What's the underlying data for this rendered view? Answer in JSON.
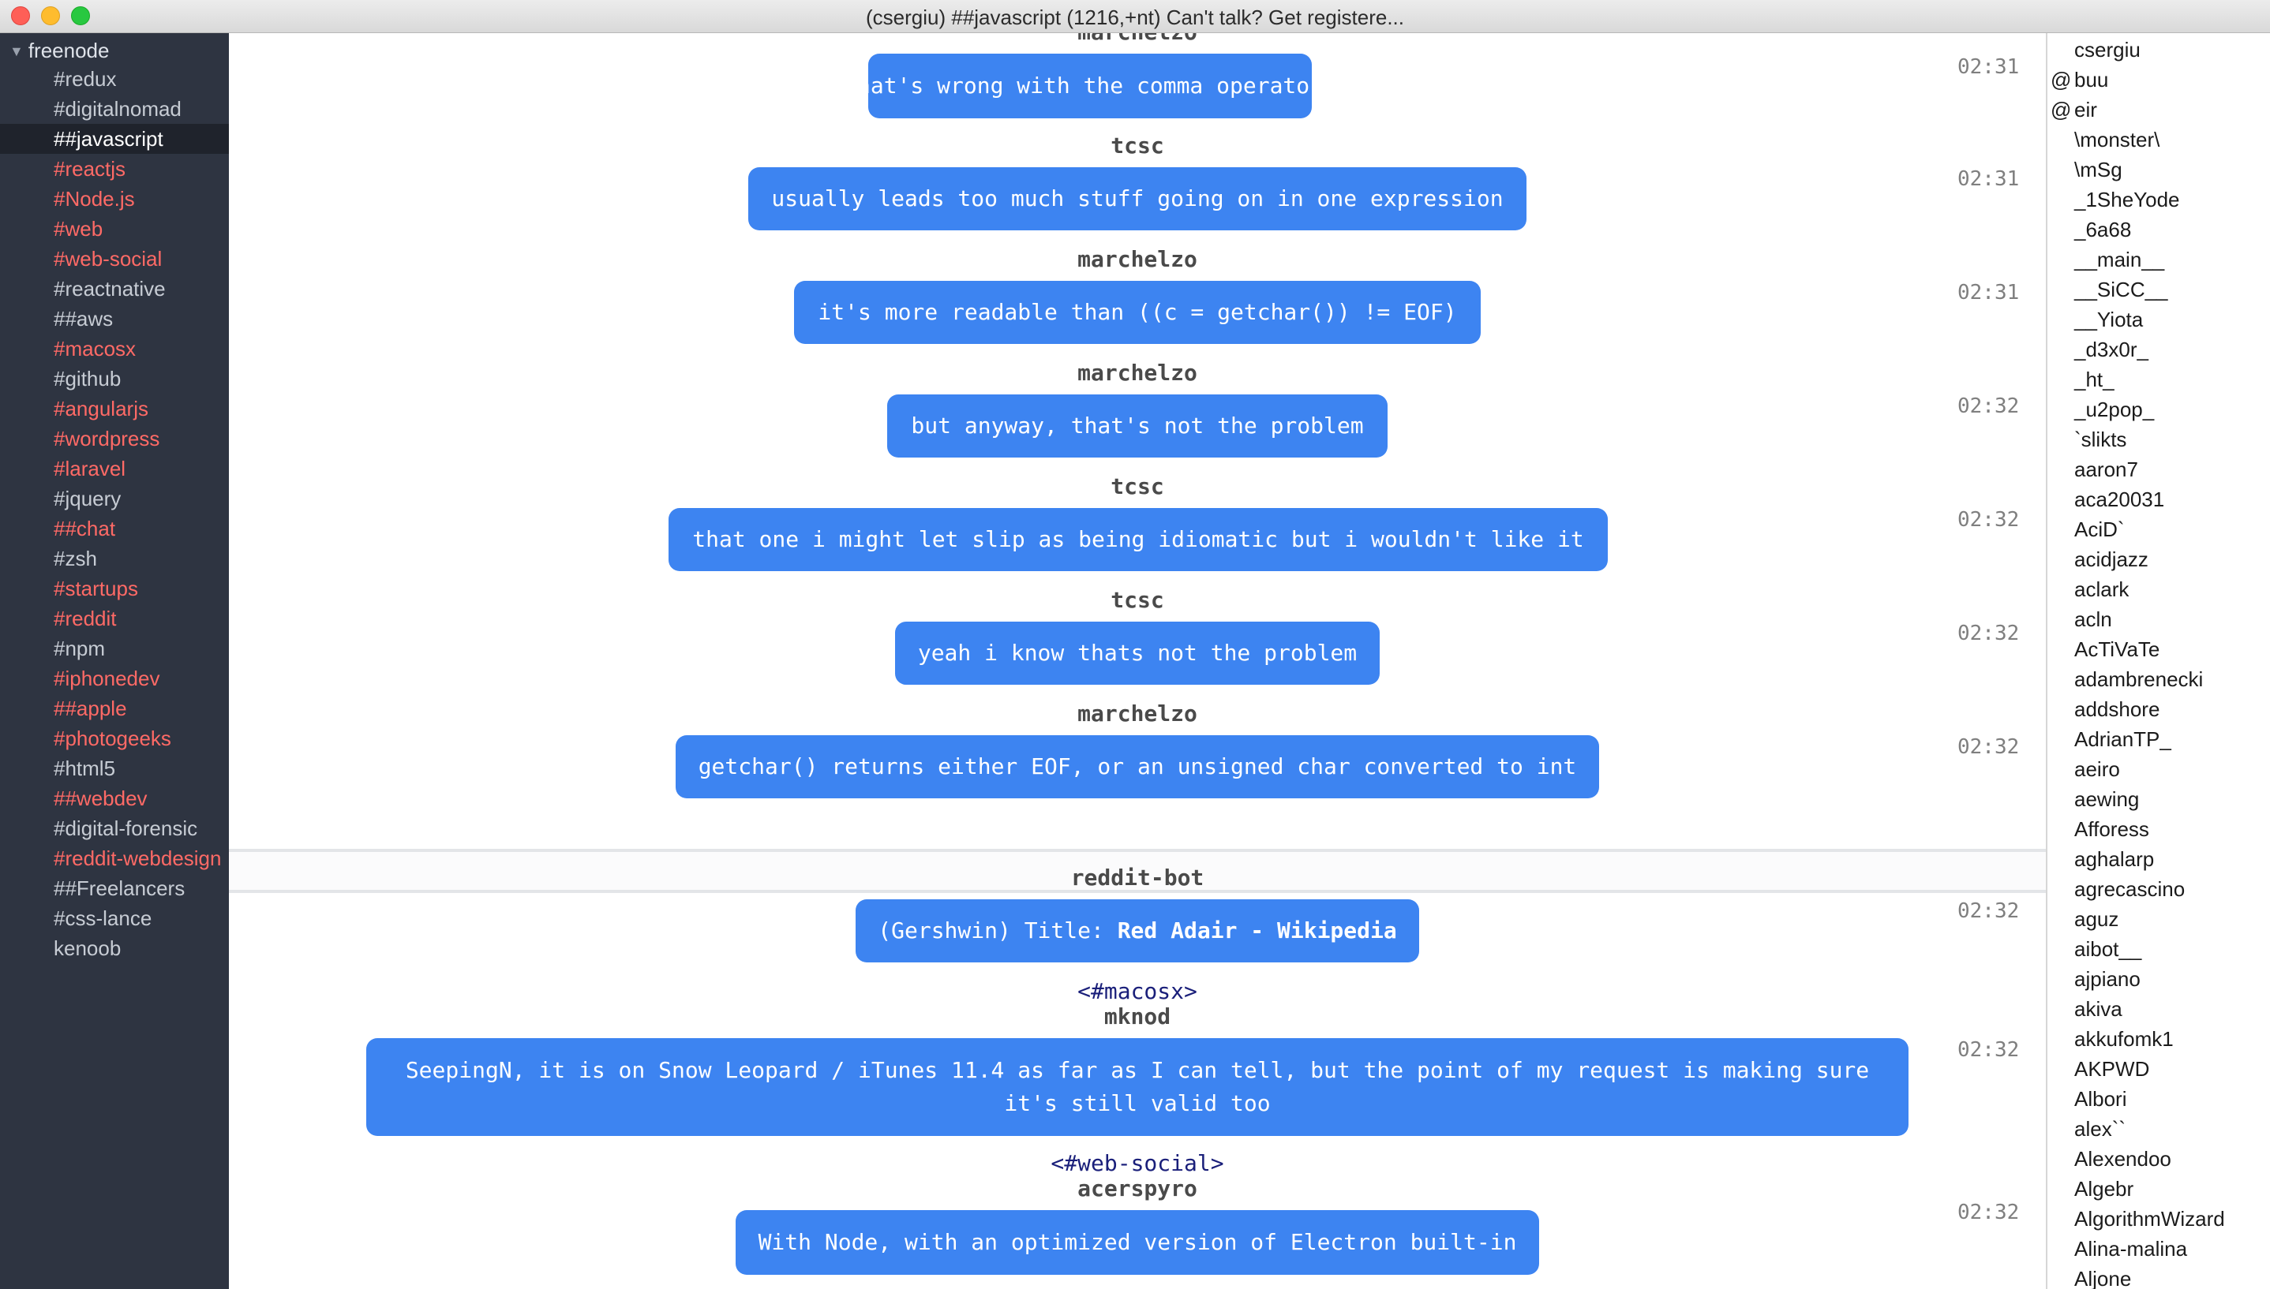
{
  "window": {
    "title": "(csergiu) ##javascript (1216,+nt) Can't talk? Get registere..."
  },
  "sidebar": {
    "network": "freenode",
    "channels": [
      {
        "name": "#redux",
        "unread": false
      },
      {
        "name": "#digitalnomad",
        "unread": false
      },
      {
        "name": "##javascript",
        "unread": false,
        "active": true
      },
      {
        "name": "#reactjs",
        "unread": true
      },
      {
        "name": "#Node.js",
        "unread": true
      },
      {
        "name": "#web",
        "unread": true
      },
      {
        "name": "#web-social",
        "unread": true
      },
      {
        "name": "#reactnative",
        "unread": false
      },
      {
        "name": "##aws",
        "unread": false
      },
      {
        "name": "#macosx",
        "unread": true
      },
      {
        "name": "#github",
        "unread": false
      },
      {
        "name": "#angularjs",
        "unread": true
      },
      {
        "name": "#wordpress",
        "unread": true
      },
      {
        "name": "#laravel",
        "unread": true
      },
      {
        "name": "#jquery",
        "unread": false
      },
      {
        "name": "##chat",
        "unread": true
      },
      {
        "name": "#zsh",
        "unread": false
      },
      {
        "name": "#startups",
        "unread": true
      },
      {
        "name": "#reddit",
        "unread": true
      },
      {
        "name": "#npm",
        "unread": false
      },
      {
        "name": "#iphonedev",
        "unread": true
      },
      {
        "name": "##apple",
        "unread": true
      },
      {
        "name": "#photogeeks",
        "unread": true
      },
      {
        "name": "#html5",
        "unread": false
      },
      {
        "name": "##webdev",
        "unread": true
      },
      {
        "name": "#digital-forensic",
        "unread": false
      },
      {
        "name": "#reddit-webdesign",
        "unread": true
      },
      {
        "name": "##Freelancers",
        "unread": false
      },
      {
        "name": "#css-lance",
        "unread": false
      },
      {
        "name": "kenoob",
        "unread": false
      }
    ]
  },
  "messages": {
    "top_partial_nick": "marchelzo",
    "items": [
      {
        "nick": "",
        "text": "what's wrong with the comma operator?",
        "time": "02:31"
      },
      {
        "nick": "tcsc",
        "text": "usually leads too much stuff going on in one expression",
        "time": "02:31"
      },
      {
        "nick": "marchelzo",
        "text": "it's more readable than ((c = getchar()) != EOF)",
        "time": "02:31"
      },
      {
        "nick": "marchelzo",
        "text": "but anyway, that's not the problem",
        "time": "02:32"
      },
      {
        "nick": "tcsc",
        "text": "that one i might let slip as being idiomatic but i wouldn't like it",
        "time": "02:32"
      },
      {
        "nick": "tcsc",
        "text": "yeah i know thats not the problem",
        "time": "02:32"
      },
      {
        "nick": "marchelzo",
        "text": "getchar() returns either EOF, or an unsigned char converted to int",
        "time": "02:32"
      },
      {
        "nick": "reddit-bot",
        "text_prefix": "(Gershwin) Title: ",
        "text_bold": "Red Adair - Wikipedia",
        "time": "02:32"
      },
      {
        "channel": "<#macosx>",
        "nick": "mknod",
        "text": "SeepingN, it is on Snow Leopard / iTunes 11.4 as far as I can tell, but the point of my request is making sure it's still valid too",
        "time": "02:32"
      },
      {
        "channel": "<#web-social>",
        "nick": "acerspyro",
        "text": "With Node, with an optimized version of Electron built-in",
        "time": "02:32"
      }
    ]
  },
  "userlist": {
    "users": [
      {
        "mode": "",
        "name": "csergiu"
      },
      {
        "mode": "@",
        "name": "buu"
      },
      {
        "mode": "@",
        "name": "eir"
      },
      {
        "mode": "",
        "name": "\\monster\\"
      },
      {
        "mode": "",
        "name": "\\mSg"
      },
      {
        "mode": "",
        "name": "_1SheYode"
      },
      {
        "mode": "",
        "name": "_6a68"
      },
      {
        "mode": "",
        "name": "__main__"
      },
      {
        "mode": "",
        "name": "__SiCC__"
      },
      {
        "mode": "",
        "name": "__Yiota"
      },
      {
        "mode": "",
        "name": "_d3x0r_"
      },
      {
        "mode": "",
        "name": "_ht_"
      },
      {
        "mode": "",
        "name": "_u2pop_"
      },
      {
        "mode": "",
        "name": "`slikts"
      },
      {
        "mode": "",
        "name": "aaron7"
      },
      {
        "mode": "",
        "name": "aca20031"
      },
      {
        "mode": "",
        "name": "AciD`"
      },
      {
        "mode": "",
        "name": "acidjazz"
      },
      {
        "mode": "",
        "name": "aclark"
      },
      {
        "mode": "",
        "name": "acln"
      },
      {
        "mode": "",
        "name": "AcTiVaTe"
      },
      {
        "mode": "",
        "name": "adambrenecki"
      },
      {
        "mode": "",
        "name": "addshore"
      },
      {
        "mode": "",
        "name": "AdrianTP_"
      },
      {
        "mode": "",
        "name": "aeiro"
      },
      {
        "mode": "",
        "name": "aewing"
      },
      {
        "mode": "",
        "name": "Afforess"
      },
      {
        "mode": "",
        "name": "aghalarp"
      },
      {
        "mode": "",
        "name": "agrecascino"
      },
      {
        "mode": "",
        "name": "aguz"
      },
      {
        "mode": "",
        "name": "aibot__"
      },
      {
        "mode": "",
        "name": "ajpiano"
      },
      {
        "mode": "",
        "name": "akiva"
      },
      {
        "mode": "",
        "name": "akkufomk1"
      },
      {
        "mode": "",
        "name": "AKPWD"
      },
      {
        "mode": "",
        "name": "Albori"
      },
      {
        "mode": "",
        "name": "alex``"
      },
      {
        "mode": "",
        "name": "Alexendoo"
      },
      {
        "mode": "",
        "name": "Algebr"
      },
      {
        "mode": "",
        "name": "AlgorithmWizard"
      },
      {
        "mode": "",
        "name": "Alina-malina"
      },
      {
        "mode": "",
        "name": "Aljone"
      }
    ]
  },
  "colors": {
    "bubble": "#3d84f1",
    "sidebar_bg": "#2e3441",
    "unread_channel": "#ff6a66",
    "channel_tag": "#1a1f7a"
  }
}
